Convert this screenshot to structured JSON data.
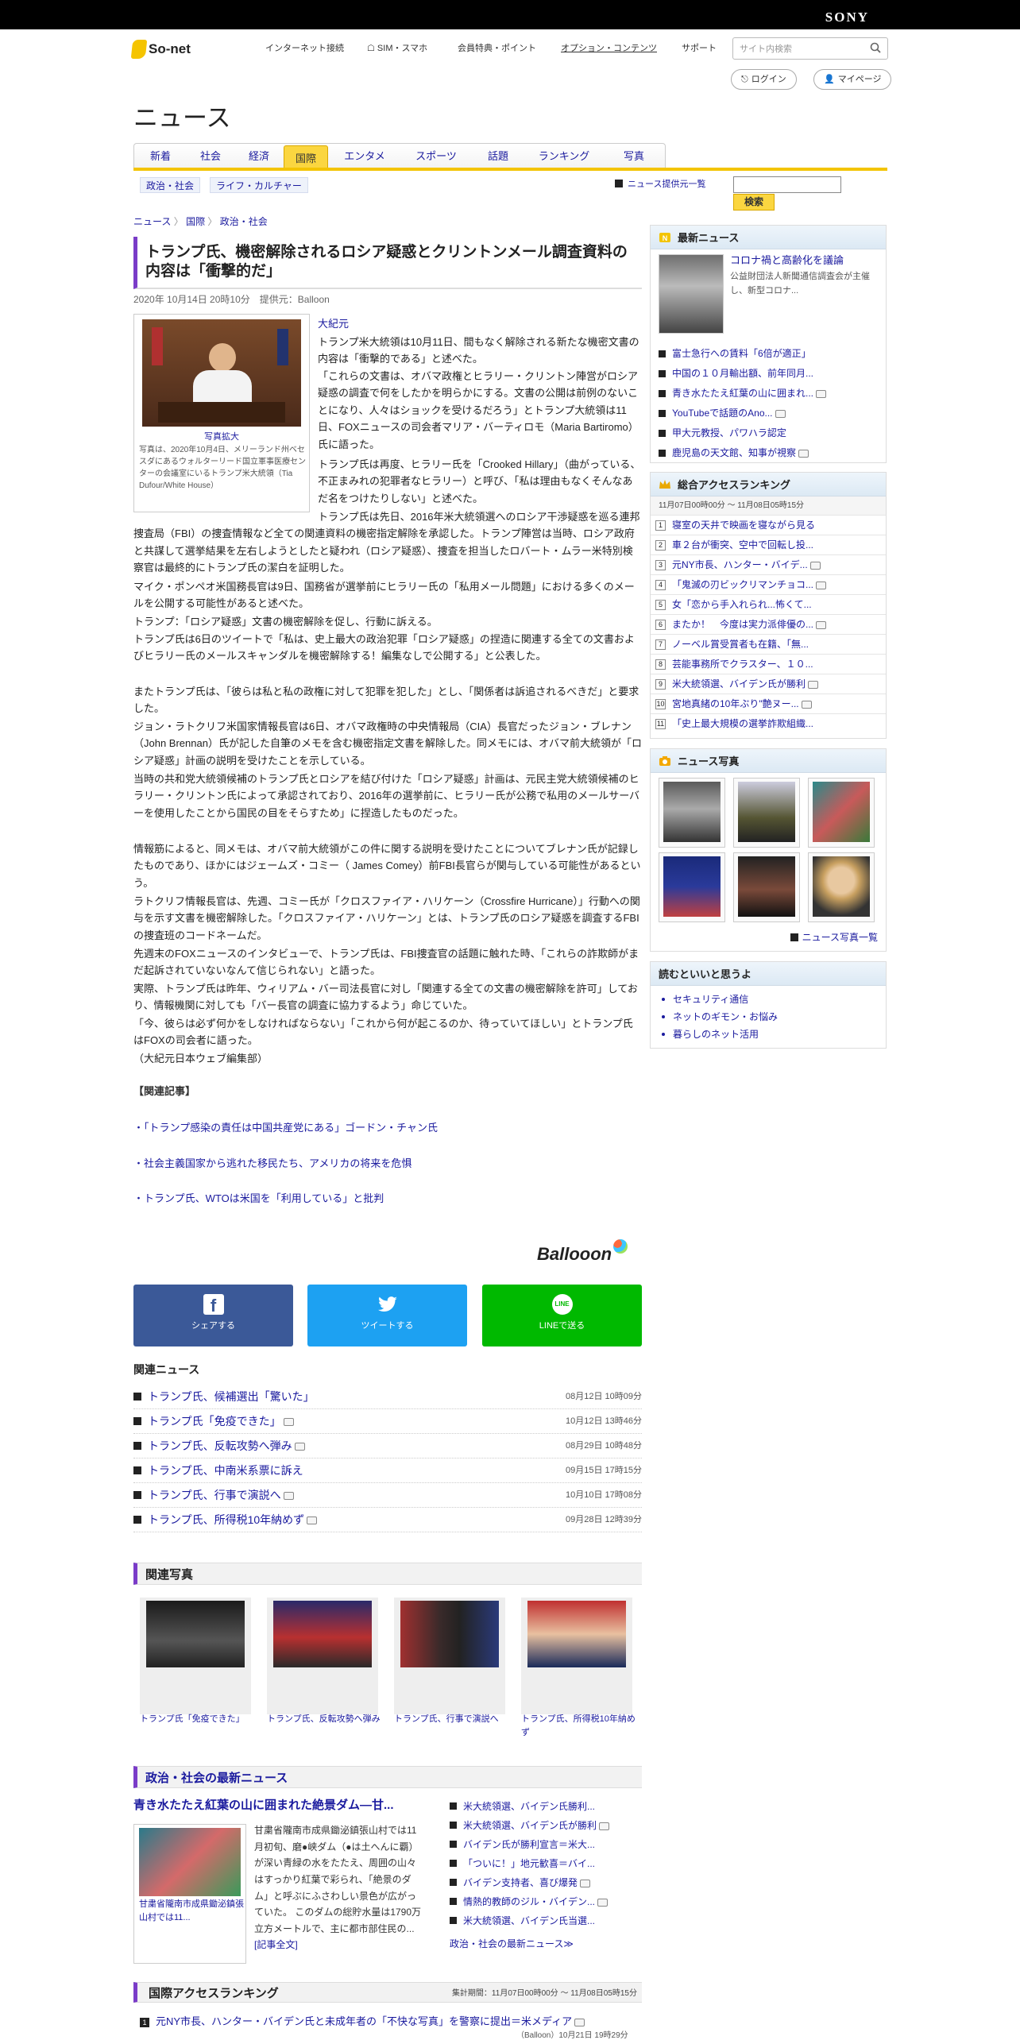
{
  "sony": "SONY",
  "site_name": "So-net",
  "top_nav": [
    "インターネット接続",
    "SIM・スマホ",
    "会員特典・ポイント",
    "オプション・コンテンツ",
    "サポート"
  ],
  "search_placeholder": "サイト内検索",
  "login": "ログイン",
  "mypage": "マイページ",
  "section_title": "ニュース",
  "genre_tabs": [
    "新着",
    "社会",
    "経済",
    "国際",
    "エンタメ",
    "スポーツ",
    "話題",
    "ランキング",
    "写真"
  ],
  "sub_tags": [
    "政治・社会",
    "ライフ・カルチャー"
  ],
  "provider_link": "ニュース提供元一覧",
  "search_button": "検索",
  "breadcrumb": [
    "ニュース",
    "国際",
    "政治・社会"
  ],
  "article": {
    "title": "トランプ氏、機密解除されるロシア疑惑とクリントンメール調査資料の内容は「衝撃的だ」",
    "date": "2020年 10月14日 20時10分",
    "provider": "提供元：Balloon",
    "photo_link": "写真拡大",
    "photo_caption": "写真は、2020年10月4日、メリーランド州ベセスダにあるウォルターリード国立軍事医療センターの会議室にいるトランプ米大統領（Tia Dufour/White House）",
    "source": "大紀元",
    "p1": "トランプ米大統領は10月11日、間もなく解除される新たな機密文書の内容は「衝撃的である」と述べた。",
    "p2": "「これらの文書は、オバマ政権とヒラリー・クリントン陣営がロシア疑惑の調査で何をしたかを明らかにする。文書の公開は前例のないことになり、人々はショックを受けるだろう」とトランプ大統領は11日、FOXニュースの司会者マリア・バーティロモ（Maria Bartiromo）氏に語った。",
    "p3": "トランプ氏は再度、ヒラリー氏を「Crooked Hillary」（曲がっている、不正まみれの犯罪者なヒラリー）と呼び、「私は理由もなくそんなあだ名をつけたりしない」と述べた。",
    "p4": "トランプ氏は先日、2016年米大統領選へのロシア干渉疑惑を巡る連邦捜査局（FBI）の捜査情報など全ての関連資料の機密指定解除を承認した。トランプ陣営は当時、ロシア政府と共謀して選挙結果を左右しようとしたと疑われ（ロシア疑惑）、捜査を担当したロバート・ムラー米特別検察官は最終的にトランプ氏の潔白を証明した。",
    "p5": "マイク・ポンペオ米国務長官は9日、国務省が選挙前にヒラリー氏の「私用メール問題」における多くのメールを公開する可能性があると述べた。",
    "p6": "トランプ：「ロシア疑惑」文書の機密解除を促し、行動に訴える。",
    "p7": "トランプ氏は6日のツイートで「私は、史上最大の政治犯罪「ロシア疑惑」の捏造に関連する全ての文書およびヒラリー氏のメールスキャンダルを機密解除する！編集なしで公開する」と公表した。",
    "p8": "またトランプ氏は、「彼らは私と私の政権に対して犯罪を犯した」とし、「関係者は訴追されるべきだ」と要求した。",
    "p9": "ジョン・ラトクリフ米国家情報長官は6日、オバマ政権時の中央情報局（CIA）長官だったジョン・ブレナン（John Brennan）氏が記した自筆のメモを含む機密指定文書を解除した。同メモには、オバマ前大統領が「ロシア疑惑」計画の説明を受けたことを示している。",
    "p10": "当時の共和党大統領候補のトランプ氏とロシアを結び付けた「ロシア疑惑」計画は、元民主党大統領候補のヒラリー・クリントン氏によって承認されており、2016年の選挙前に、ヒラリー氏が公務で私用のメールサーバーを使用したことから国民の目をそらすため」に捏造したものだった。",
    "p11": "情報筋によると、同メモは、オバマ前大統領がこの件に関する説明を受けたことについてブレナン氏が記録したものであり、ほかにはジェームズ・コミー（ James Comey）前FBI長官らが関与している可能性があるという。",
    "p12": "ラトクリフ情報長官は、先週、コミー氏が「クロスファイア・ハリケーン（Crossfire Hurricane）」行動への関与を示す文書を機密解除した。「クロスファイア・ハリケーン」とは、トランプ氏のロシア疑惑を調査するFBIの捜査班のコードネームだ。",
    "p13": "先週末のFOXニュースのインタビューで、トランプ氏は、FBI捜査官の話題に触れた時、「これらの詐欺師がまだ起訴されていないなんて信じられない」と語った。",
    "p14": "実際、トランプ氏は昨年、ウィリアム・バー司法長官に対し「関連する全ての文書の機密解除を許可」しており、情報機関に対しても「バー長官の調査に協力するよう」命じていた。",
    "p15": "「今、彼らは必ず何かをしなければならない」「これから何が起こるのか、待っていてほしい」とトランプ氏はFOXの司会者に語った。",
    "p16": "（大紀元日本ウェブ編集部）",
    "related_heading": "【関連記事】",
    "related": [
      "・「トランプ感染の責任は中国共産党にある」ゴードン・チャン氏",
      "・社会主義国家から逃れた移民たち、アメリカの将来を危惧",
      "・トランプ氏、WTOは米国を「利用している」と批判"
    ]
  },
  "balloon_logo": "Ballooon",
  "share": {
    "facebook": "シェアする",
    "twitter": "ツイートする",
    "line": "LINEで送る",
    "line_glyph": "LINE"
  },
  "related_news_heading": "関連ニュース",
  "related_news": [
    {
      "title": "トランプ氏、候補選出「驚いた」",
      "date": "08月12日 10時09分"
    },
    {
      "title": "トランプ氏「免疫できた」",
      "date": "10月12日 13時46分"
    },
    {
      "title": "トランプ氏、反転攻勢へ弾み",
      "date": "08月29日 10時48分"
    },
    {
      "title": "トランプ氏、中南米系票に訴え",
      "date": "09月15日 17時15分"
    },
    {
      "title": "トランプ氏、行事で演説へ",
      "date": "10月10日 17時08分"
    },
    {
      "title": "トランプ氏、所得税10年納めず",
      "date": "09月28日 12時39分"
    }
  ],
  "related_photos_heading": "関連写真",
  "related_photos": [
    "トランプ氏「免疫できた」",
    "トランプ氏、反転攻勢へ弾み",
    "トランプ氏、行事で演説へ",
    "トランプ氏、所得税10年納めず"
  ],
  "latest_section_heading": "政治・社会の最新ニュース",
  "latest_featured": {
    "title": "青き水たたえ紅葉の山に囲まれた絶景ダム―甘...",
    "caption": "甘粛省隴南市成県鋤泌鎮張山村では11...",
    "text": "甘粛省隴南市成県鋤泌鎮張山村では11月初旬、磨●峡ダム（●は土へんに覇）が深い青緑の水をたたえ、周囲の山々はすっかり紅葉で彩られ、「絶景のダム」と呼ぶにふさわしい景色が広がっていた。 このダムの総貯水量は1790万立方メートルで、主に都市部住民の...",
    "more": "[記事全文]"
  },
  "latest_list": [
    "米大統領選、バイデン氏勝利...",
    "米大統領選、バイデン氏が勝利",
    "バイデン氏が勝利宣言＝米大...",
    "「ついに！」地元歓喜＝バイ...",
    "バイデン支持者、喜び爆発",
    "情熱的教師のジル・バイデン...",
    "米大統領選、バイデン氏当選..."
  ],
  "latest_more": "政治・社会の最新ニュース≫",
  "intl_ranking_heading": "国際アクセスランキング",
  "intl_ranking_period": "集計期間：11月07日00時00分 ～ 11月08日05時15分",
  "intl_rank1": "元NY市長、ハンター・バイデン氏と未成年者の「不快な写真」を警察に提出＝米メディア",
  "intl_rank1_meta": "（Balloon）10月21日 19時29分",
  "sidebar": {
    "latest_heading": "最新ニュース",
    "latest_top_title": "コロナ禍と高齢化を議論",
    "latest_top_desc": "公益財団法人新聞通信調査会が主催し、新型コロナ...",
    "latest_items": [
      "富士急行への賃料「6倍が適正」",
      "中国の１０月輸出額、前年同月...",
      "青き水たたえ紅葉の山に囲まれ...",
      "YouTubeで話題のAno...",
      "甲大元教授、パワハラ認定",
      "鹿児島の天文館、知事が視察"
    ],
    "ranking_heading": "総合アクセスランキング",
    "ranking_period": "11月07日00時00分 ～ 11月08日05時15分",
    "ranking": [
      "寝室の天井で映画を寝ながら見る",
      "車２台が衝突、空中で回転し投...",
      "元NY市長、ハンター・バイデ...",
      "「鬼滅の刃ビックリマンチョコ...",
      "女「恋から手入れられ...怖くて...",
      "またか！　今度は実力派俳優の...",
      "ノーベル賞受賞者も在籍、「無...",
      "芸能事務所でクラスター、１０...",
      "米大統領選、バイデン氏が勝利",
      "宮地真緒の10年ぶり\"艶ヌー...",
      "「史上最大規模の選挙詐欺組織..."
    ],
    "photos_heading": "ニュース写真",
    "photos_more": "ニュース写真一覧",
    "recommend_heading": "読むといいと思うよ",
    "recommend": [
      "セキュリティ通信",
      "ネットのギモン・お悩み",
      "暮らしのネット活用"
    ]
  }
}
